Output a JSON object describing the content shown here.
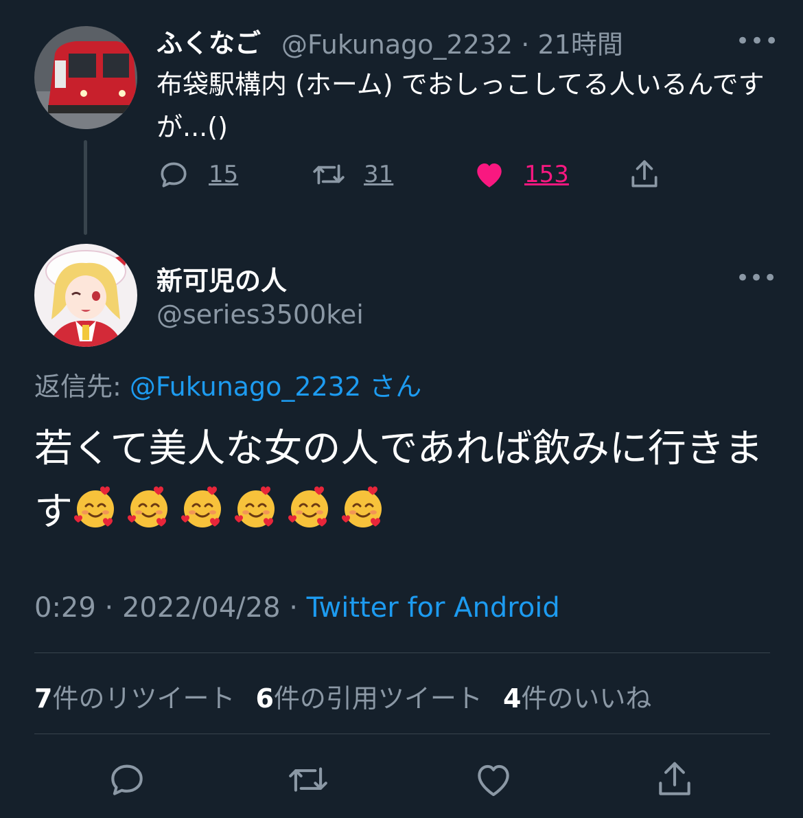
{
  "parent_tweet": {
    "display_name": "ふくなご",
    "handle_time": "@Fukunago_2232 · 21時間",
    "text": "布袋駅構内 (ホーム) でおしっこしてる人いるんですが...()",
    "reply_count": "15",
    "retweet_count": "31",
    "like_count": "153"
  },
  "reply_tweet": {
    "display_name": "新可児の人",
    "handle": "@series3500kei",
    "replying_label": "返信先:",
    "replying_to": "@Fukunago_2232",
    "replying_suffix": "さん",
    "text": "若くて美人な女の人であれば飲みに行きます",
    "emoji_count": 6,
    "time_date": "0:29 · 2022/04/28 ·",
    "source": "Twitter for Android"
  },
  "stats": {
    "retweets_num": "7",
    "retweets_label": "件のリツイート",
    "quotes_num": "6",
    "quotes_label": "件の引用ツイート",
    "likes_num": "4",
    "likes_label": "件のいいね"
  },
  "colors": {
    "background": "#15202b",
    "accent": "#1d9bf0",
    "like": "#f91880",
    "muted": "#8b98a5"
  }
}
